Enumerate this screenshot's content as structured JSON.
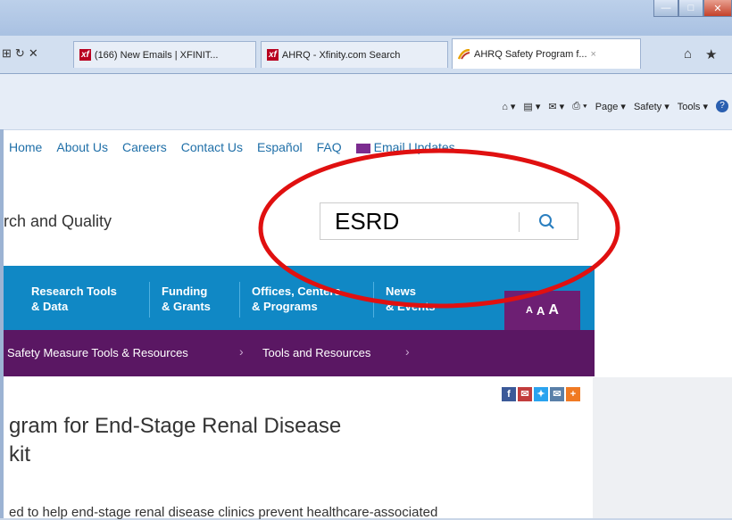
{
  "browser": {
    "tabs": [
      {
        "label": "(166) New Emails | XFINIT...",
        "icon": "xf"
      },
      {
        "label": "AHRQ - Xfinity.com Search",
        "icon": "xf"
      },
      {
        "label": "AHRQ Safety Program f...",
        "icon": "ahrq"
      }
    ],
    "xf_label": "xf",
    "tab_close": "×",
    "nav_controls": [
      "⊞",
      "↻",
      "✕"
    ],
    "command_bar": [
      "Page ▾",
      "Safety ▾",
      "Tools ▾"
    ]
  },
  "site": {
    "top_nav": [
      "Home",
      "About Us",
      "Careers",
      "Contact Us",
      "Español",
      "FAQ"
    ],
    "email_updates": "Email Updates",
    "brand_fragment": "rch and Quality",
    "search": {
      "value": "ESRD"
    },
    "main_nav": [
      {
        "line1": "Research Tools",
        "line2": "& Data"
      },
      {
        "line1": "Funding",
        "line2": "& Grants"
      },
      {
        "line1": "Offices, Centers",
        "line2": "& Programs"
      },
      {
        "line1": "News",
        "line2": "& Events"
      }
    ],
    "text_size": [
      "A",
      "A",
      "A"
    ],
    "breadcrumbs": [
      "Safety Measure Tools & Resources",
      "Tools and Resources"
    ],
    "breadcrumb_sep": "›",
    "title_line1": "gram for End-Stage Renal Disease",
    "title_line2": "kit",
    "description": "ed to help end-stage renal disease clinics prevent healthcare-associated"
  },
  "colors": {
    "nav_blue": "#1088c5",
    "crumb_purple": "#5a1763",
    "annotation_red": "#e01010"
  }
}
